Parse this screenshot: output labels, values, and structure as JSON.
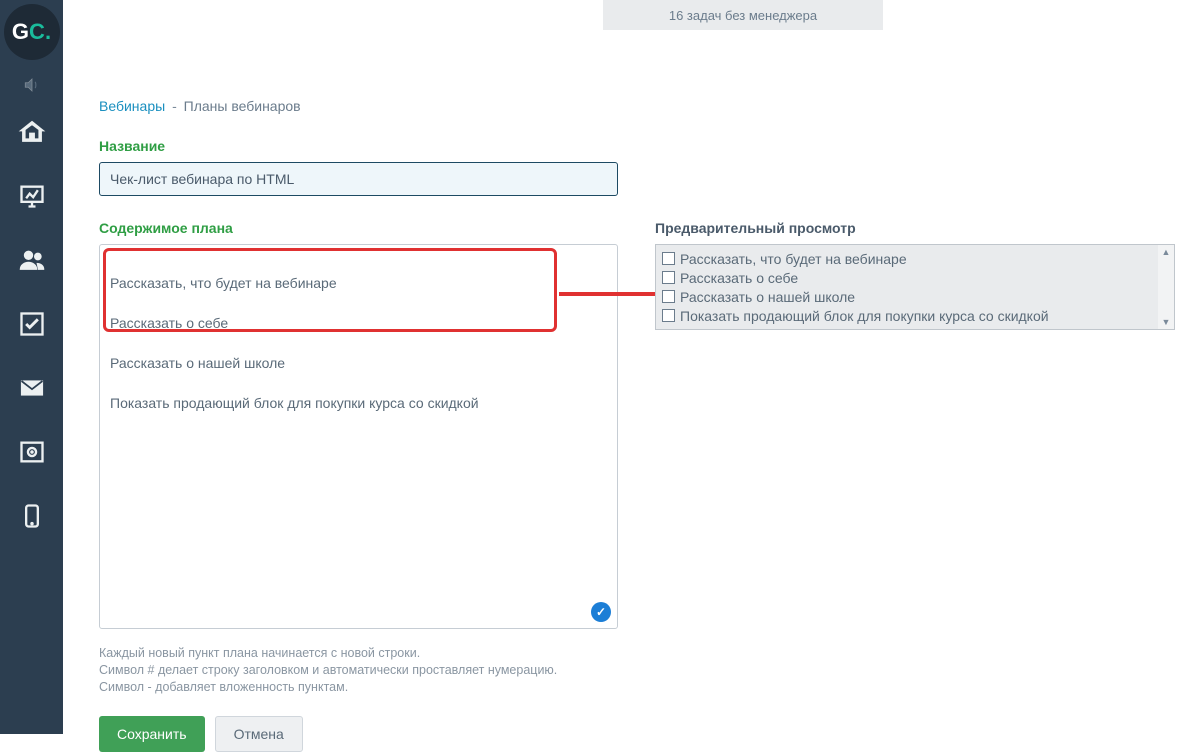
{
  "topNotice": "16 задач без менеджера",
  "breadcrumb": {
    "link": "Вебинары",
    "sep": "-",
    "current": "Планы вебинаров"
  },
  "labels": {
    "name": "Название",
    "content": "Содержимое плана",
    "preview": "Предварительный просмотр"
  },
  "nameValue": "Чек-лист вебинара по HTML",
  "planLines": [
    "Рассказать, что будет на вебинаре",
    "Рассказать о себе",
    "Рассказать о нашей школе",
    "Показать продающий блок для покупки курса со скидкой"
  ],
  "previewItems": [
    "Рассказать, что будет на вебинаре",
    "Рассказать о себе",
    "Рассказать о нашей школе",
    "Показать продающий блок для покупки курса со скидкой"
  ],
  "help": {
    "l1": "Каждый новый пункт плана начинается с новой строки.",
    "l2": "Символ # делает строку заголовком и автоматически проставляет нумерацию.",
    "l3": "Символ - добавляет вложенность пунктам."
  },
  "buttons": {
    "save": "Сохранить",
    "cancel": "Отмена"
  },
  "colors": {
    "accent": "#40a057",
    "link": "#1a8fbf",
    "highlight": "#e03131"
  }
}
